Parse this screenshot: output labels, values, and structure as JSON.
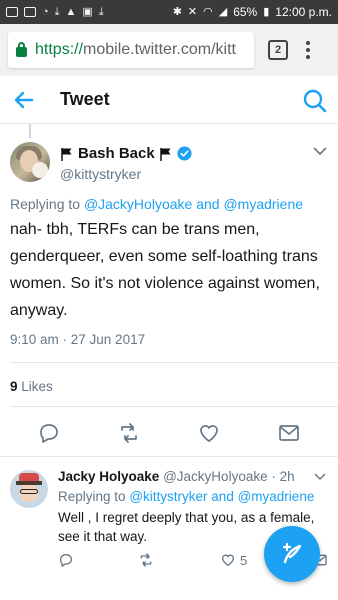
{
  "status_bar": {
    "battery": "65%",
    "time": "12:00 p.m."
  },
  "browser": {
    "url_scheme": "https://",
    "url_host": "mobile.twitter.com/kitt",
    "tab_count": "2"
  },
  "header": {
    "title": "Tweet"
  },
  "main_tweet": {
    "display_name": "Bash Back",
    "handle": "@kittystryker",
    "replying_prefix": "Replying to",
    "replying_to_1": "@JackyHolyoake",
    "replying_and": "and",
    "replying_to_2": "@myadriene",
    "text": "nah- tbh, TERFs can be trans men, genderqueer, even some self-loathing trans women. So it's not violence against women, anyway.",
    "timestamp": "9:10 am · 27 Jun 2017",
    "likes_count": "9",
    "likes_label": "Likes"
  },
  "reply_tweet": {
    "display_name": "Jacky Holyoake",
    "handle": "@JackyHolyoake",
    "separator": "·",
    "time": "2h",
    "replying_prefix": "Replying to",
    "replying_to_1": "@kittystryker",
    "replying_and": "and",
    "replying_to_2": "@myadriene",
    "text": "Well , I regret deeply that you, as a female, see it that way.",
    "like_count": "5"
  },
  "colors": {
    "accent": "#1da1f2",
    "secure_green": "#0b8043",
    "muted": "#657786",
    "divider": "#e1e8ed"
  },
  "icons": {
    "back": "arrow-left-icon",
    "search": "search-icon",
    "reply": "reply-icon",
    "retweet": "retweet-icon",
    "like": "heart-icon",
    "message": "envelope-icon",
    "compose": "compose-icon"
  }
}
